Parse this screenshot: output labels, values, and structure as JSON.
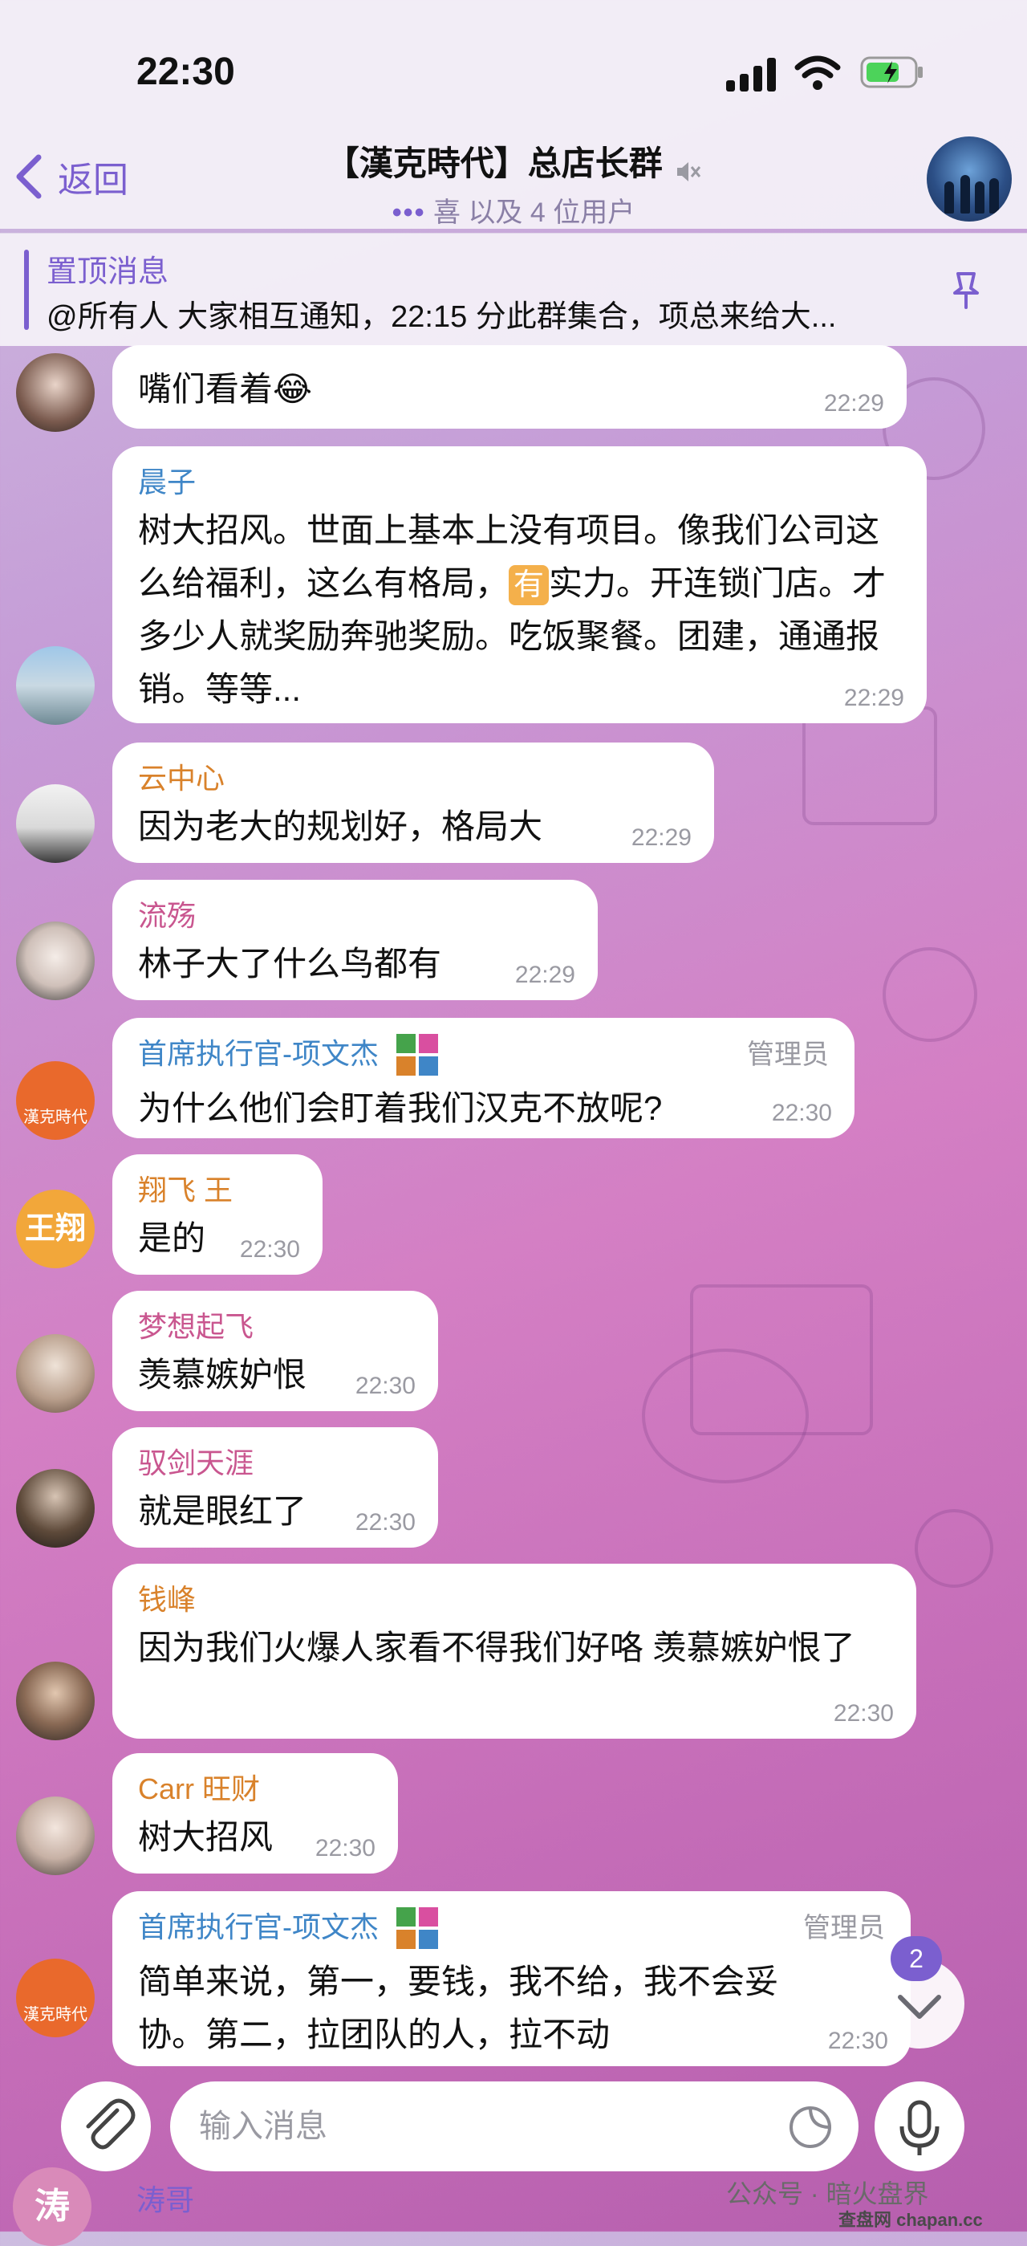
{
  "status": {
    "time": "22:30"
  },
  "header": {
    "back_label": "返回",
    "title": "【漢克時代】总店长群",
    "subtitle_dots": "•••",
    "subtitle": "喜 以及 4 位用户"
  },
  "pinned": {
    "title": "置顶消息",
    "text": "@所有人 大家相互通知，22:15 分此群集合，项总来给大..."
  },
  "messages": [
    {
      "sender": "",
      "text": "嘴们看着😂",
      "time": "22:29"
    },
    {
      "sender": "晨子",
      "text_a": "树大招风。世面上基本上没有项目。像我们公司这么给福利，这么有格局，",
      "badge": "有",
      "text_b": "实力。开连锁门店。才多少人就奖励奔驰奖励。吃饭聚餐。团建，通通报销。等等...",
      "time": "22:29"
    },
    {
      "sender": "云中心",
      "text": "因为老大的规划好，格局大",
      "time": "22:29"
    },
    {
      "sender": "流殇",
      "text": "林子大了什么鸟都有",
      "time": "22:29"
    },
    {
      "sender": "首席执行官-项文杰",
      "admin": "管理员",
      "text": "为什么他们会盯着我们汉克不放呢?",
      "time": "22:30"
    },
    {
      "sender": "翔飞 王",
      "avatar_text": "王翔",
      "text": "是的",
      "time": "22:30"
    },
    {
      "sender": "梦想起飞",
      "text": "羡慕嫉妒恨",
      "time": "22:30"
    },
    {
      "sender": "驭剑天涯",
      "text": "就是眼红了",
      "time": "22:30"
    },
    {
      "sender": "钱峰",
      "text": "因为我们火爆人家看不得我们好咯 羡慕嫉妒恨了",
      "time": "22:30"
    },
    {
      "sender": "Carr 旺财",
      "text": "树大招风",
      "time": "22:30"
    },
    {
      "sender": "首席执行官-项文杰",
      "admin": "管理员",
      "text": "简单来说，第一，要钱，我不给，我不会妥协。第二，拉团队的人，拉不动",
      "time": "22:30"
    }
  ],
  "logo_text": "漢克時代",
  "unread_count": "2",
  "input": {
    "placeholder": "输入消息"
  },
  "peek": {
    "avatar_text": "涛",
    "name": "涛哥"
  },
  "watermark": {
    "line1": "公众号 · 暗火盘界",
    "line2": "查盘网 chapan.cc"
  },
  "colors": {
    "accent": "#7b5fcf",
    "sender_blue": "#3f86c7",
    "sender_orange": "#d9822b",
    "sender_pink": "#c9568f",
    "sender_purple": "#8f5fcf",
    "sender_green": "#45a34b"
  }
}
